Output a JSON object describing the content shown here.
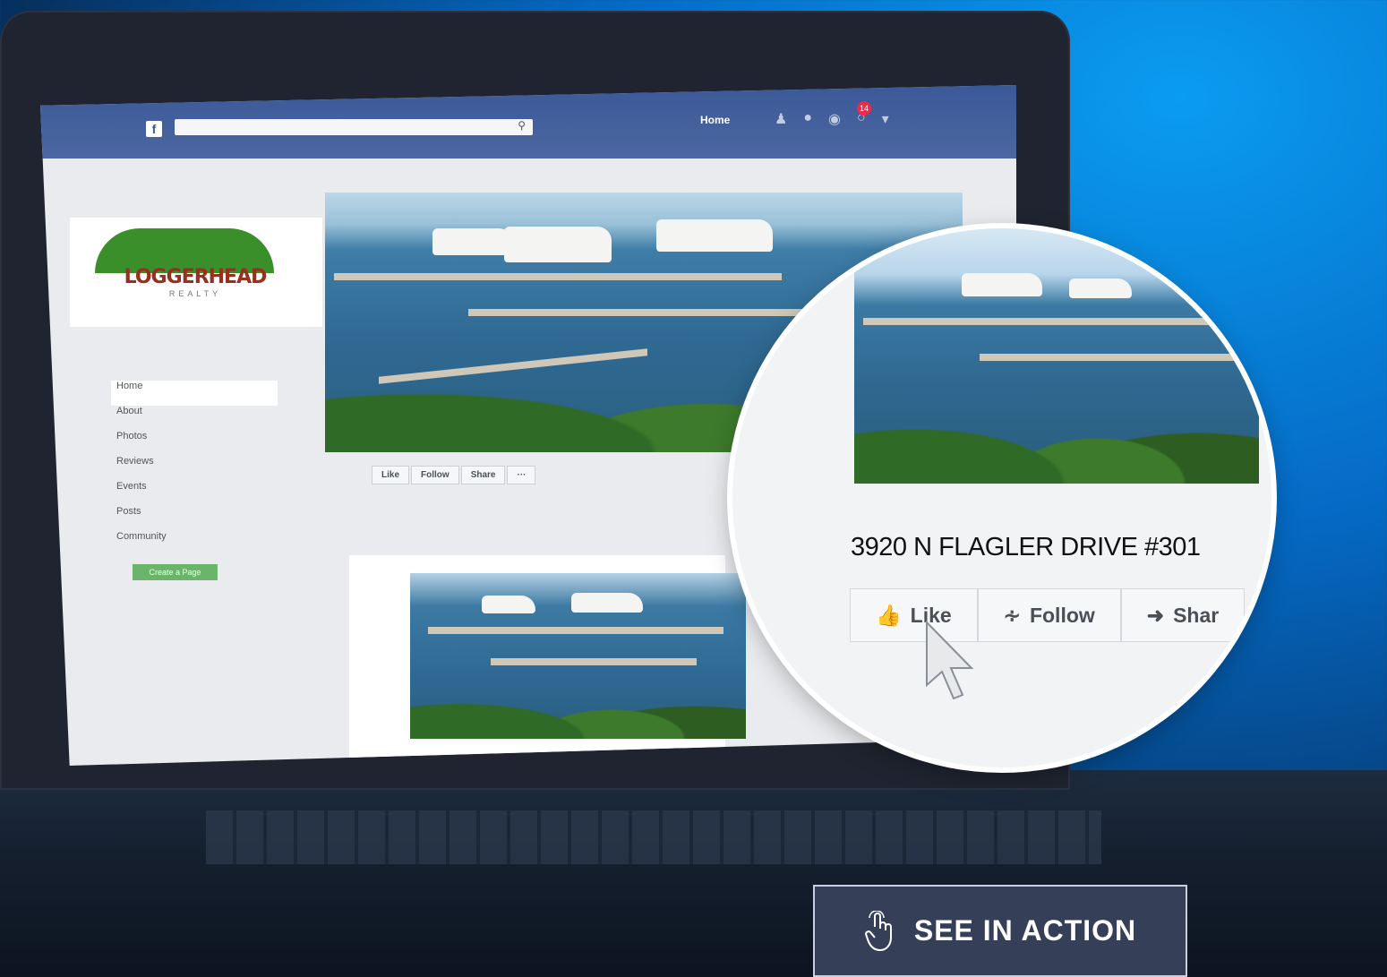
{
  "facebook": {
    "logo": "f",
    "nav_home": "Home",
    "notification_count": "14"
  },
  "page": {
    "brand_name": "LOGGERHEAD",
    "brand_sub": "REALTY",
    "nav": [
      "Home",
      "About",
      "Photos",
      "Reviews",
      "Events",
      "Posts",
      "Community"
    ],
    "create_page": "Create a Page",
    "actions": [
      "Like",
      "Follow",
      "Share",
      "···"
    ]
  },
  "zoom": {
    "title": "3920 N FLAGLER DRIVE #301",
    "like": "Like",
    "follow": "Follow",
    "share": "Shar"
  },
  "cta": {
    "label": "SEE IN ACTION",
    "icon": "tap-hand-icon"
  }
}
